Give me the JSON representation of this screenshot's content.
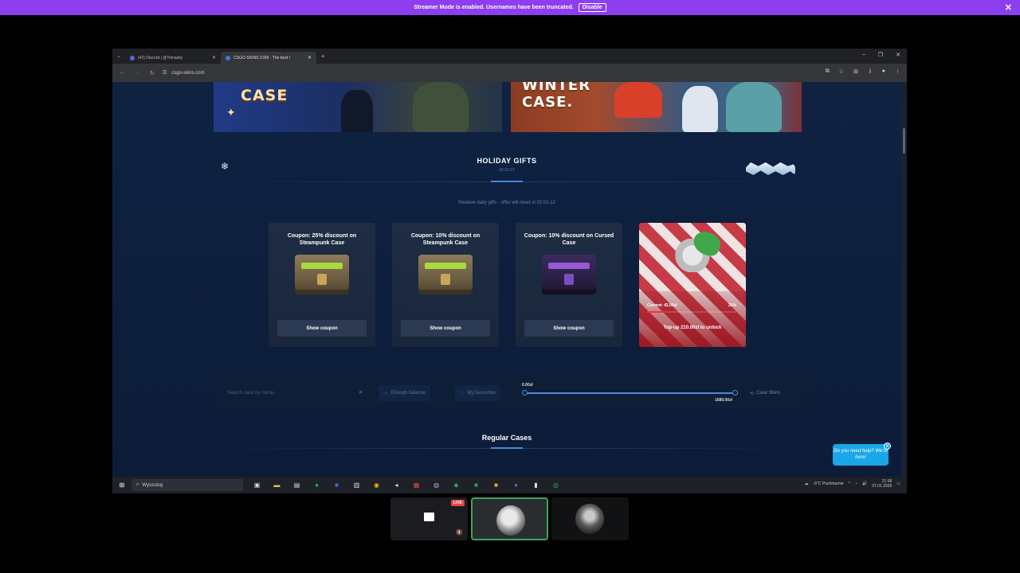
{
  "streamer": {
    "message": "Streamer Mode is enabled. Usernames have been truncated.",
    "disable_label": "Disable",
    "close": "✕"
  },
  "browser": {
    "tabs": [
      {
        "label": "(42) Discord | @Tomasity",
        "icon_color": "#5865f2"
      },
      {
        "label": "CSGO-SKINS.COM - The best !",
        "icon_color": "#3d7bd9"
      }
    ],
    "new_tab": "+",
    "url": "csgo-skins.com",
    "window_controls": [
      "–",
      "❐",
      "✕"
    ]
  },
  "banners": {
    "left_title": "CASE",
    "right_title": "WINTER\nCASE."
  },
  "holiday": {
    "title": "HOLIDAY GIFTS",
    "timer": "02:01:12",
    "offer_text": "Receive daily gifts - offer will reset in 02:01:12",
    "gifts": [
      {
        "title": "Coupon: 25% discount on Steampunk Case",
        "button": "Show coupon"
      },
      {
        "title": "Coupon: 10% discount on Steampunk Case",
        "button": "Show coupon"
      },
      {
        "title": "Coupon: 10% discount on Cursed Case",
        "button": "Show coupon"
      }
    ],
    "topup": {
      "current": "Current: 42.00zł",
      "percent": "20%",
      "progress": 0.2,
      "button": "Top-up 210.00zł to unlock"
    }
  },
  "filters": {
    "search_placeholder": "Search case by name...",
    "enough_balance": "Enough balance",
    "my_favourites": "My favourites",
    "range_min": "0.00zł",
    "range_max": "1680.00zł",
    "clear_filters": "Clear filters"
  },
  "regular": {
    "title": "Regular Cases"
  },
  "help": {
    "text": "Do you need help? We're here!",
    "close": "✕"
  },
  "taskbar": {
    "search_label": "Wyszukaj",
    "weather": "-6°C  Pochmurnie",
    "time": "21:58",
    "date": "07.01.2026"
  },
  "call": {
    "live_label": "LIVE"
  }
}
